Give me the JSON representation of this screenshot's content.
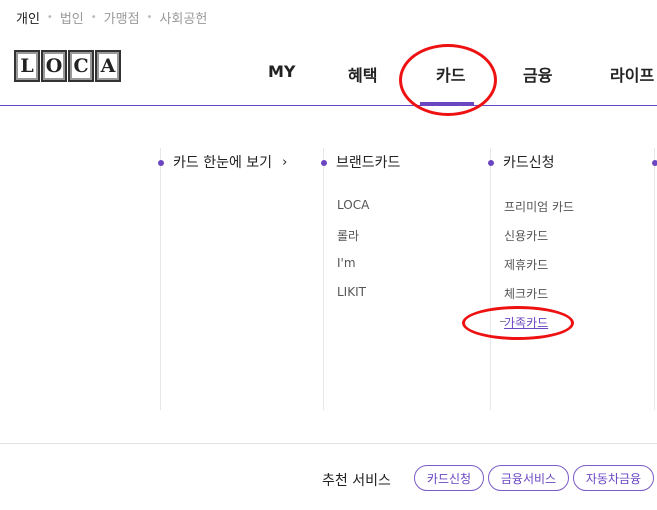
{
  "top_nav": [
    "개인",
    "법인",
    "가맹점",
    "사회공헌"
  ],
  "logo_letters": [
    "L",
    "O",
    "C",
    "A"
  ],
  "main_nav": [
    "MY",
    "혜택",
    "카드",
    "금융",
    "라이프"
  ],
  "menu": {
    "col1": {
      "title": "카드 한눈에 보기",
      "chevron": "›"
    },
    "col2": {
      "title": "브랜드카드",
      "items": [
        "LOCA",
        "롤라",
        "I'm",
        "LIKIT"
      ]
    },
    "col3": {
      "title": "카드신청",
      "items": [
        "프리미엄 카드",
        "신용카드",
        "제휴카드",
        "체크카드",
        "가족카드"
      ]
    }
  },
  "recommend": {
    "label": "추천 서비스",
    "buttons": [
      "카드신청",
      "금융서비스",
      "자동차금융"
    ]
  },
  "colors": {
    "accent": "#6b46c1",
    "annotation": "#e11111"
  }
}
